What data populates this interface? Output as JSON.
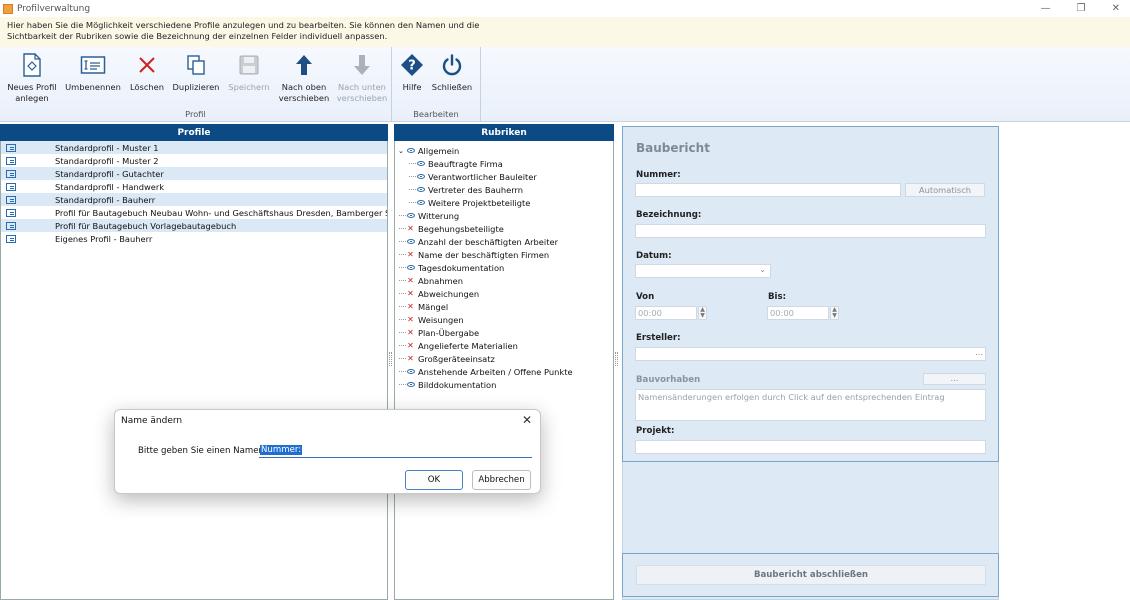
{
  "window": {
    "title": "Profilverwaltung"
  },
  "info": {
    "line1": "Hier haben Sie die Möglichkeit verschiedene Profile anzulegen und zu bearbeiten. Sie können den Namen und die",
    "line2": "Sichtbarkeit der Rubriken sowie die Bezeichnung der einzelnen Felder individuell anpassen."
  },
  "ribbon": {
    "profil_group": "Profil",
    "bearbeiten_group": "Bearbeiten",
    "buttons": {
      "neues1": "Neues Profil",
      "neues2": "anlegen",
      "umbenennen": "Umbenennen",
      "loeschen": "Löschen",
      "duplizieren": "Duplizieren",
      "speichern": "Speichern",
      "nachoben1": "Nach oben",
      "nachoben2": "verschieben",
      "nachunten1": "Nach unten",
      "nachunten2": "verschieben",
      "hilfe": "Hilfe",
      "schliessen": "Schließen"
    }
  },
  "profiles": {
    "header": "Profile",
    "items": [
      "Standardprofil - Muster 1",
      "Standardprofil - Muster 2",
      "Standardprofil - Gutachter",
      "Standardprofil - Handwerk",
      "Standardprofil - Bauherr",
      "Profil für Bautagebuch Neubau Wohn- und Geschäftshaus Dresden, Bamberger Straße",
      "Profil für Bautagebuch Vorlagebautagebuch",
      "Eigenes Profil - Bauherr"
    ]
  },
  "rubriken": {
    "header": "Rubriken",
    "root": "Allgemein",
    "children": [
      "Beauftragte Firma",
      "Verantwortlicher Bauleiter",
      "Vertreter des Bauherrn",
      "Weitere Projektbeteiligte"
    ],
    "items": [
      {
        "label": "Witterung",
        "visible": true
      },
      {
        "label": "Begehungsbeteiligte",
        "visible": false
      },
      {
        "label": "Anzahl der beschäftigten Arbeiter",
        "visible": true
      },
      {
        "label": "Name der beschäftigten Firmen",
        "visible": false
      },
      {
        "label": "Tagesdokumentation",
        "visible": true
      },
      {
        "label": "Abnahmen",
        "visible": false
      },
      {
        "label": "Abweichungen",
        "visible": false
      },
      {
        "label": "Mängel",
        "visible": false
      },
      {
        "label": "Weisungen",
        "visible": false
      },
      {
        "label": "Plan-Übergabe",
        "visible": false
      },
      {
        "label": "Angelieferte Materialien",
        "visible": false
      },
      {
        "label": "Großgeräteeinsatz",
        "visible": false
      },
      {
        "label": "Anstehende Arbeiten / Offene Punkte",
        "visible": true
      },
      {
        "label": "Bilddokumentation",
        "visible": true
      }
    ]
  },
  "form": {
    "title": "Baubericht",
    "nummer": "Nummer:",
    "automatisch": "Automatisch",
    "bezeichnung": "Bezeichnung:",
    "datum": "Datum:",
    "von": "Von",
    "bis": "Bis:",
    "von_value": "00:00",
    "bis_value": "00:00",
    "ersteller": "Ersteller:",
    "ersteller_btn": "...",
    "bauvorhaben": "Bauvorhaben",
    "bauvorhaben_btn": "...",
    "hint": "Namensänderungen erfolgen durch Click auf den entsprechenden Eintrag",
    "projekt": "Projekt:",
    "close_button": "Baubericht abschließen"
  },
  "dialog": {
    "title": "Name ändern",
    "prompt": "Bitte geben Sie einen Namen ein:",
    "value": "Nummer:",
    "ok": "OK",
    "cancel": "Abbrechen"
  }
}
